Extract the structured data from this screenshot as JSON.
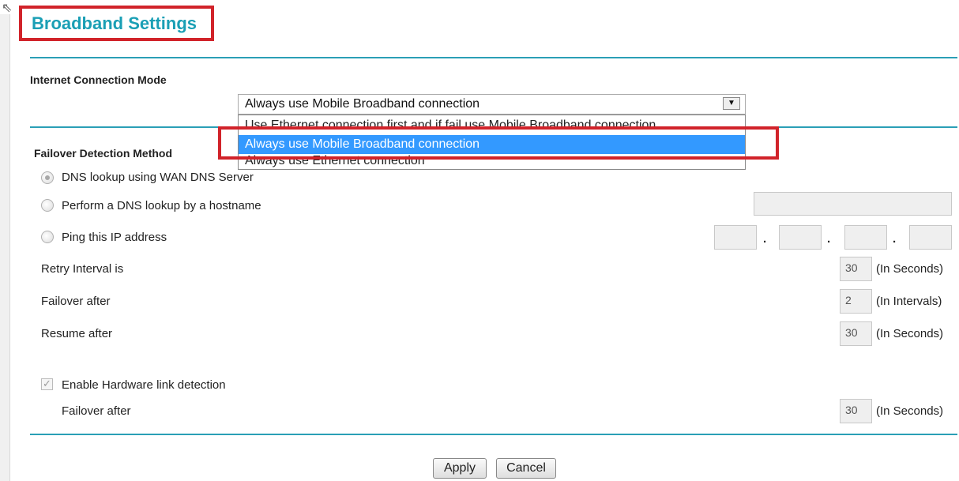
{
  "page": {
    "title": "Broadband Settings"
  },
  "connection_mode": {
    "label": "Internet Connection Mode",
    "selected": "Always use Mobile Broadband connection",
    "options": [
      "Use Ethernet connection first and if fail use Mobile Broadband connection",
      "Always use Mobile Broadband connection",
      "Always use Ethernet connection"
    ],
    "highlighted_index": 1
  },
  "failover": {
    "label": "Failover Detection Method",
    "options": [
      "DNS lookup using WAN DNS Server",
      "Perform a DNS lookup by a hostname",
      "Ping this IP address"
    ],
    "selected_index": 0,
    "hostname_value": "",
    "ip_dot": "."
  },
  "intervals": {
    "retry_label": "Retry Interval is",
    "retry_value": "30",
    "retry_unit": "(In Seconds)",
    "failover_label": "Failover after",
    "failover_value": "2",
    "failover_unit": "(In  Intervals)",
    "resume_label": "Resume after",
    "resume_value": "30",
    "resume_unit": "(In Seconds)"
  },
  "hardware": {
    "enable_label": "Enable Hardware link detection",
    "checked": true,
    "failover_label": "Failover after",
    "failover_value": "30",
    "failover_unit": "(In Seconds)"
  },
  "buttons": {
    "apply": "Apply",
    "cancel": "Cancel"
  },
  "colors": {
    "accent": "#2a9fb6",
    "title": "#1a9fb5",
    "highlight_box": "#d1232a",
    "selected_option": "#3399ff"
  }
}
